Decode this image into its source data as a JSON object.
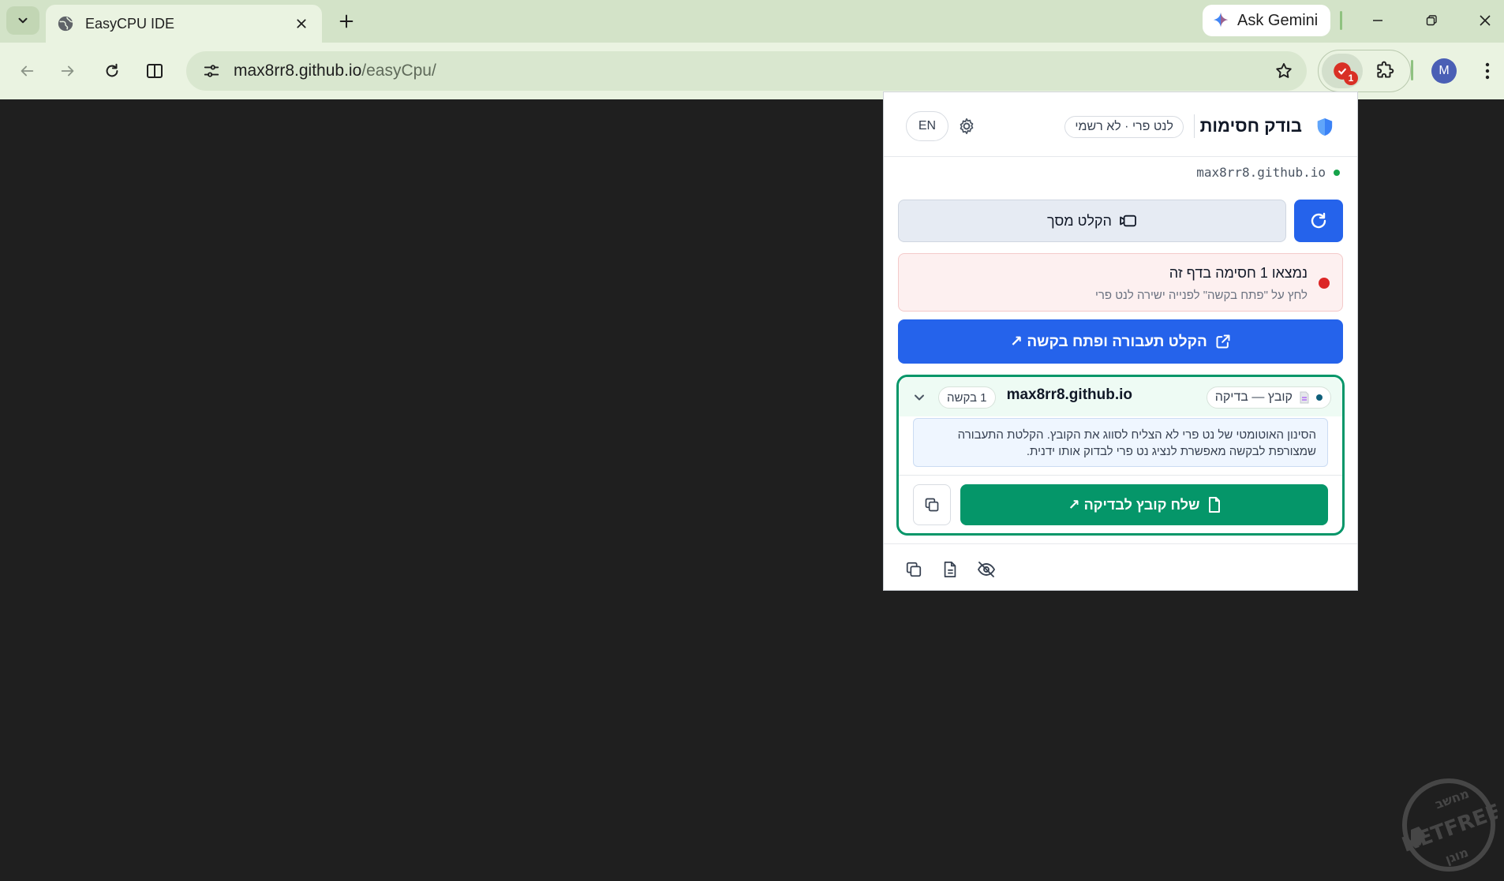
{
  "browser": {
    "tab_title": "EasyCPU IDE",
    "gemini_label": "Ask Gemini",
    "url_host": "max8rr8.github.io",
    "url_path": "/easyCpu/",
    "avatar_initial": "M",
    "extension_badge": "1"
  },
  "popup": {
    "title": "בודק חסימות",
    "subtitle": "לנט פרי · לא רשמי",
    "language": "EN",
    "host": "max8rr8.github.io",
    "record_label": "הקלט מסך",
    "alert_title": "נמצאו 1 חסימה בדף זה",
    "alert_sub": "לחץ על \"פתח בקשה\" לפנייה ישירה לנט פרי",
    "primary_label": "הקלט תעבורה ופתח בקשה ↗",
    "card": {
      "status_label": "קובץ — בדיקה",
      "host": "max8rr8.github.io",
      "count_label": "1 בקשה",
      "note": "הסינון האוטומטי של נט פרי לא הצליח לסווג את הקובץ. הקלטת התעבורה שמצורפת לבקשה מאפשרת לנציג נט פרי לבדוק אותו ידנית.",
      "send_label": "שלח קובץ לבדיקה ↗"
    }
  },
  "watermark": {
    "top": "מחשב",
    "brand": "NETFREE",
    "bottom": "מוגן"
  },
  "colors": {
    "accent_blue": "#2563eb",
    "accent_green": "#059669",
    "alert_red": "#dc2626",
    "chrome_green": "#d3e3c8"
  }
}
